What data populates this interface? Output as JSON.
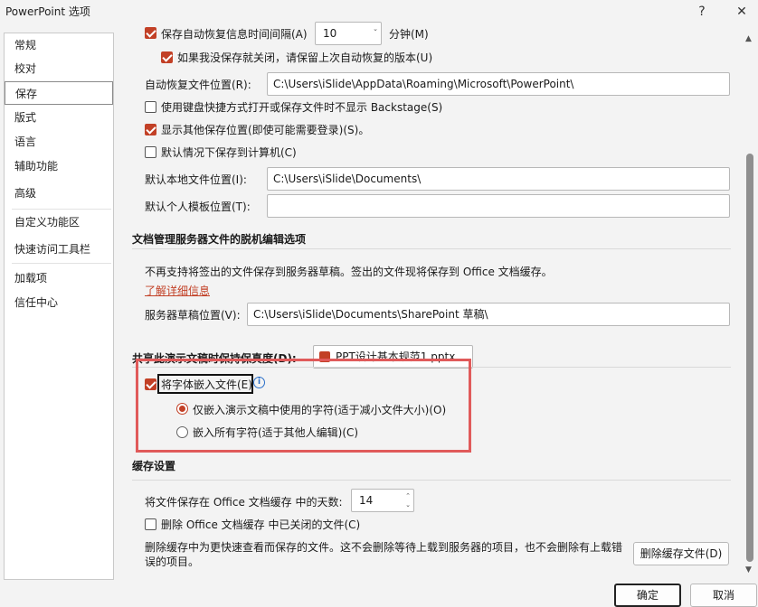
{
  "window": {
    "title": "PowerPoint 选项",
    "help": "?",
    "close": "✕"
  },
  "nav": {
    "items": [
      {
        "label": "常规"
      },
      {
        "label": "校对"
      },
      {
        "label": "保存"
      },
      {
        "label": "版式"
      },
      {
        "label": "语言"
      },
      {
        "label": "辅助功能"
      },
      {
        "label": "高级"
      },
      {
        "label": "自定义功能区"
      },
      {
        "label": "快速访问工具栏"
      },
      {
        "label": "加载项"
      },
      {
        "label": "信任中心"
      }
    ]
  },
  "save": {
    "autorecover_label_partial": "保存自动恢复信息时间间隔(A)",
    "autorecover_minutes": "10",
    "minutes_unit": "分钟(M)",
    "keep_last_label": "如果我没保存就关闭，请保留上次自动恢复的版本(U)",
    "autorecover_location_label": "自动恢复文件位置(R):",
    "autorecover_location_value": "C:\\Users\\iSlide\\AppData\\Roaming\\Microsoft\\PowerPoint\\",
    "no_backstage_label": "使用键盘快捷方式打开或保存文件时不显示 Backstage(S)",
    "show_other_locations_label": "显示其他保存位置(即使可能需要登录)(S)。",
    "save_to_computer_label": "默认情况下保存到计算机(C)",
    "local_location_label": "默认本地文件位置(I):",
    "local_location_value": "C:\\Users\\iSlide\\Documents\\",
    "template_location_label": "默认个人模板位置(T):",
    "template_location_value": ""
  },
  "offline": {
    "title": "文档管理服务器文件的脱机编辑选项",
    "notice": "不再支持将签出的文件保存到服务器草稿。签出的文件现将保存到 Office 文档缓存。",
    "learn_more": "了解详细信息",
    "drafts_label": "服务器草稿位置(V):",
    "drafts_value": "C:\\Users\\iSlide\\Documents\\SharePoint 草稿\\"
  },
  "fidelity": {
    "label": "共享此演示文稿时保持保真度(D):",
    "file": "PPT设计基本规范1.pptx",
    "embed_fonts_label": "将字体嵌入文件(E)",
    "info_icon": "i",
    "only_used_label": "仅嵌入演示文稿中使用的字符(适于减小文件大小)(O)",
    "embed_all_label": "嵌入所有字符(适于其他人编辑)(C)"
  },
  "cache": {
    "title": "缓存设置",
    "days_label": "将文件保存在 Office 文档缓存 中的天数:",
    "days_value": "14",
    "delete_closed_label": "删除 Office 文档缓存 中已关闭的文件(C)",
    "note": "删除缓存中为更快速查看而保存的文件。这不会删除等待上载到服务器的项目，也不会删除有上载错误的项目。",
    "delete_button": "删除缓存文件(D)"
  },
  "footer": {
    "ok": "确定",
    "cancel": "取消"
  },
  "colors": {
    "accent": "#c24026",
    "highlight_box": "#e05a5a"
  }
}
